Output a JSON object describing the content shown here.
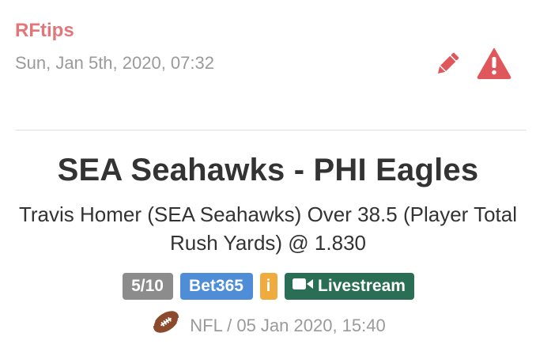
{
  "header": {
    "author": "RFtips",
    "timestamp": "Sun, Jan 5th, 2020, 07:32",
    "edit_icon": "pencil-icon",
    "report_icon": "warning-icon"
  },
  "tip": {
    "match_title": "SEA Seahawks - PHI Eagles",
    "description": "Travis Homer (SEA Seahawks) Over 38.5 (Player Total Rush Yards) @ 1.830",
    "badges": {
      "rating": "5/10",
      "bookmaker": "Bet365",
      "info": "i",
      "livestream": "Livestream"
    },
    "sport_icon": "american-football-icon",
    "meta": "NFL / 05 Jan 2020, 15:40"
  },
  "colors": {
    "author": "#e3767a",
    "icons": "#e0575b",
    "rating_badge": "#8c8c8c",
    "bookmaker_badge": "#4f8ed6",
    "info_badge": "#efab3e",
    "livestream_badge": "#2a6e55"
  }
}
